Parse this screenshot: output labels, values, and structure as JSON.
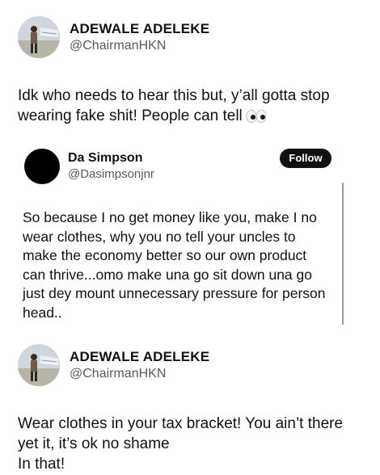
{
  "tweet1": {
    "author_name": "ADEWALE ADELEKE",
    "author_handle": "@ChairmanHKN",
    "text_line1": "Idk who needs to hear this but, y’all gotta stop",
    "text_line2": "wearing fake shit! People can tell",
    "emoji": "eyes-emoji"
  },
  "quote": {
    "author_name": "Da Simpson",
    "author_handle": "@Dasimpsonjnr",
    "follow_label": "Follow",
    "lines": [
      "So because I no get money like you, make I no",
      "wear clothes, why you no tell your uncles to",
      "make the economy better so our own product",
      "can thrive...omo make una go sit down una go",
      "just dey mount unnecessary pressure for person",
      "head.."
    ]
  },
  "tweet2": {
    "author_name": "ADEWALE ADELEKE",
    "author_handle": "@ChairmanHKN",
    "lines": [
      "Wear clothes in your tax bracket! You ain’t there",
      "yet it, it’s ok no shame",
      "In that!"
    ]
  },
  "colors": {
    "text": "#111111",
    "handle": "#55595e",
    "follow_bg": "#111111",
    "follow_text": "#ffffff"
  }
}
